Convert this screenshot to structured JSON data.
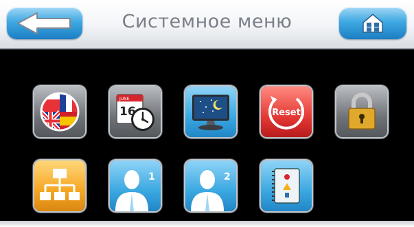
{
  "header": {
    "title": "Системное меню",
    "back_icon": "back-arrow-icon",
    "home_icon": "home-icon"
  },
  "tiles": [
    {
      "name": "language",
      "icon": "flags-globe-icon",
      "color": "#6f7378"
    },
    {
      "name": "date-time",
      "icon": "calendar-clock-icon",
      "color": "#6f7378",
      "calendar_day": "16",
      "calendar_month": "JUNE"
    },
    {
      "name": "display",
      "icon": "monitor-night-icon",
      "color": "#3ba8e1"
    },
    {
      "name": "reset",
      "icon": "reset-icon",
      "color": "#e53935",
      "label": "Reset"
    },
    {
      "name": "lock",
      "icon": "padlock-icon",
      "color": "#6f7378"
    },
    {
      "name": "network",
      "icon": "network-tree-icon",
      "color": "#f5a623"
    },
    {
      "name": "user-1",
      "icon": "user-profile-icon",
      "color": "#3ba8e1",
      "badge": "1"
    },
    {
      "name": "user-2",
      "icon": "user-profile-icon",
      "color": "#3ba8e1",
      "badge": "2"
    },
    {
      "name": "info",
      "icon": "info-book-icon",
      "color": "#3ba8e1"
    }
  ]
}
